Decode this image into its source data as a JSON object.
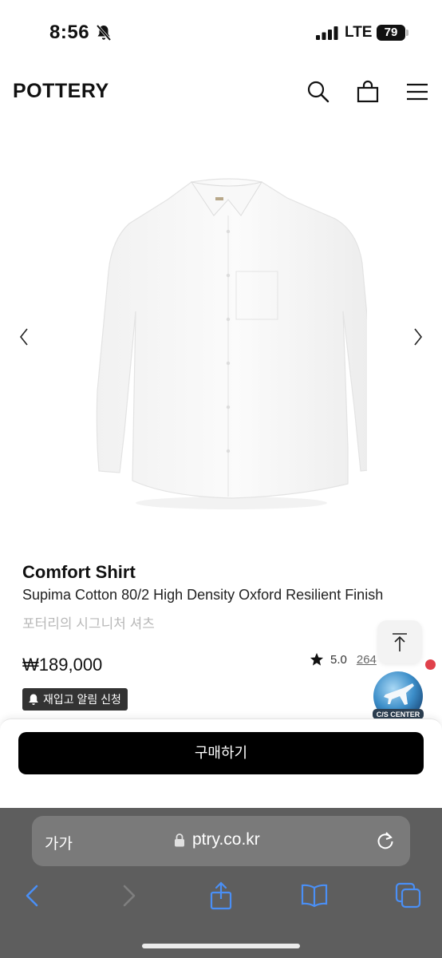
{
  "status_bar": {
    "time": "8:56",
    "network": "LTE",
    "battery": "79"
  },
  "header": {
    "logo": "POTTERY"
  },
  "product": {
    "name": "Comfort Shirt",
    "description": "Supima Cotton 80/2 High Density Oxford Resilient Finish",
    "korean_subtitle": "포터리의 시그니처 셔츠",
    "price": "₩189,000",
    "rating": {
      "score": "5.0",
      "reviews_visible": "264"
    },
    "restock_alert_label": "재입고 알림 신청"
  },
  "cs_badge": {
    "label": "C/S CENTER"
  },
  "purchase": {
    "buy_label": "구매하기"
  },
  "browser": {
    "text_size_label": "가가",
    "url": "ptry.co.kr"
  },
  "colors": {
    "accent_red": "#e0414b",
    "button_black": "#000000",
    "safari_bar": "#5e5e5e",
    "safari_blue": "#4a8ff5"
  },
  "icons": [
    "bell-slash-icon",
    "signal-icon",
    "search-icon",
    "shopping-bag-icon",
    "menu-icon",
    "chevron-left-icon",
    "chevron-right-icon",
    "star-icon",
    "bell-icon",
    "arrow-up-icon",
    "lock-icon",
    "reload-icon",
    "back-icon",
    "forward-icon",
    "share-icon",
    "bookmarks-icon",
    "tabs-icon"
  ]
}
